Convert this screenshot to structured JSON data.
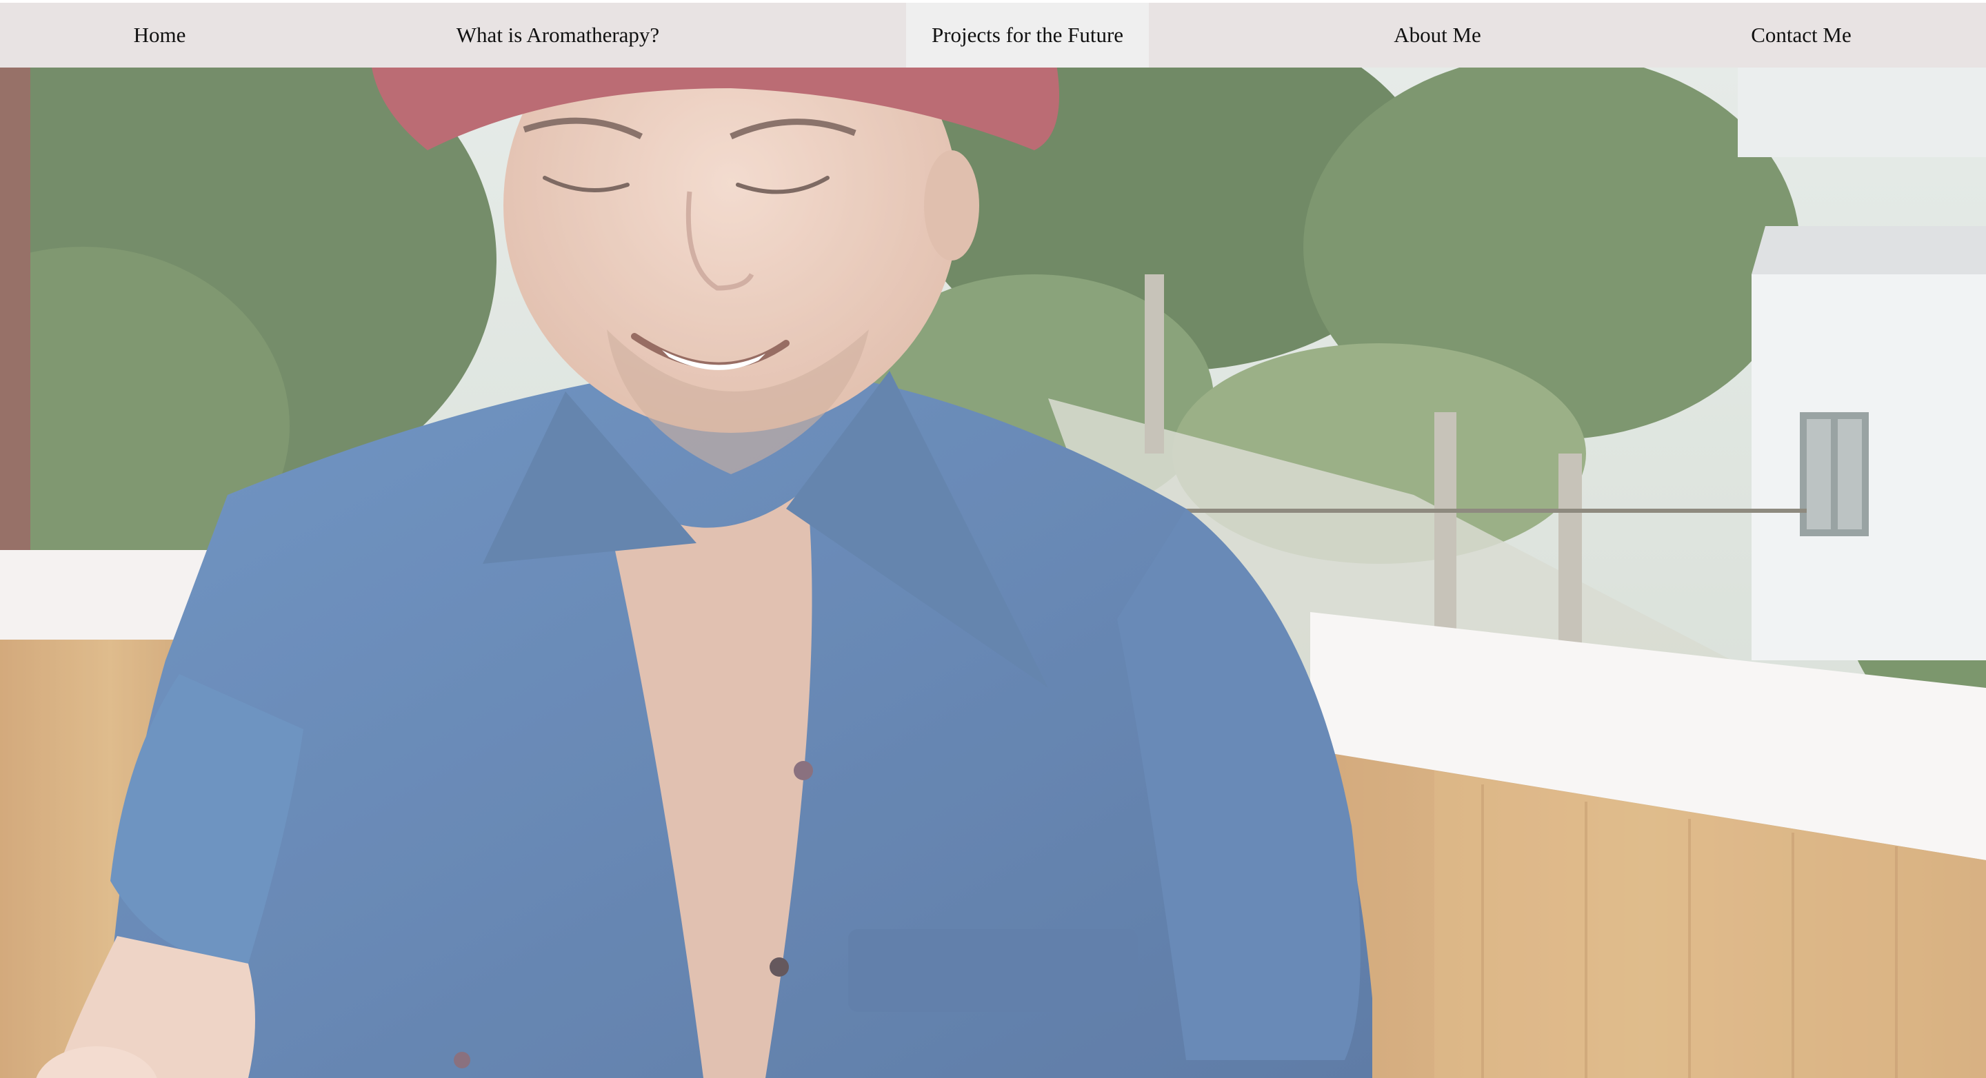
{
  "nav": {
    "items": [
      {
        "label": "Home"
      },
      {
        "label": "What is Aromatherapy?"
      },
      {
        "label": "Projects for the Future"
      },
      {
        "label": "About Me"
      },
      {
        "label": "Contact Me"
      }
    ],
    "active_index": 2
  },
  "colors": {
    "nav_background": "#e8e3e3",
    "nav_active_background": "#efefef",
    "nav_text": "#111111",
    "hat": "#a8434d",
    "shirt": "#3f6aa3",
    "skin": "#e7c2b0",
    "foliage": "#4c6b3e",
    "balcony_wall": "#f4f1ef",
    "wood_panel": "#c9975c"
  },
  "hero": {
    "image": "photo-of-smiling-man-on-balcony"
  }
}
